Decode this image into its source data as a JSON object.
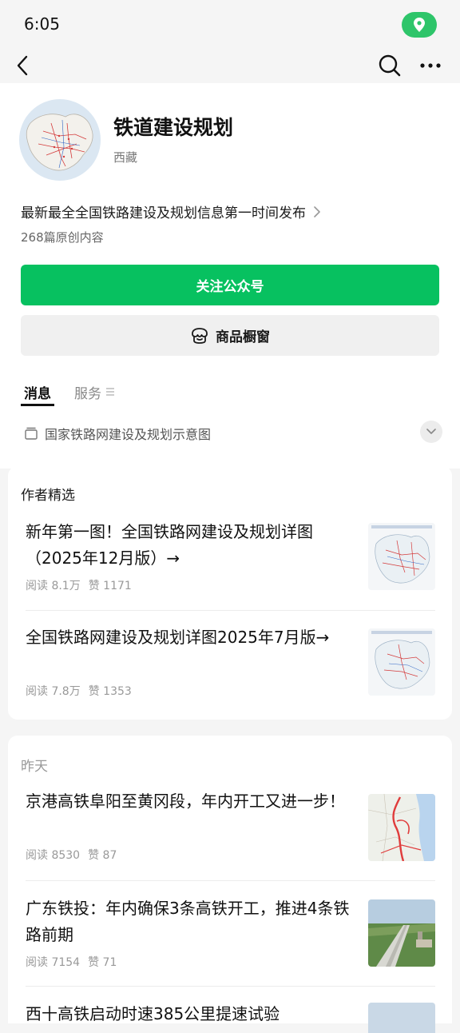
{
  "status_bar": {
    "time": "6:05"
  },
  "account": {
    "name": "铁道建设规划",
    "region": "西藏",
    "intro": "最新最全全国铁路建设及规划信息第一时间发布",
    "original_count": "268篇原创内容"
  },
  "actions": {
    "follow_label": "关注公众号",
    "shop_label": "商品橱窗"
  },
  "tabs": {
    "messages": "消息",
    "services": "服务"
  },
  "collection": {
    "label": "国家铁路网建设及规划示意图"
  },
  "featured": {
    "title": "作者精选",
    "articles": [
      {
        "title": "新年第一图！全国铁路网建设及规划详图（2025年12月版）→",
        "reads": "阅读 8.1万",
        "likes": "赞 1171"
      },
      {
        "title": "全国铁路网建设及规划详图2025年7月版→",
        "reads": "阅读 7.8万",
        "likes": "赞 1353"
      }
    ]
  },
  "yesterday": {
    "title": "昨天",
    "articles": [
      {
        "title": "京港高铁阜阳至黄冈段，年内开工又进一步！",
        "reads": "阅读 8530",
        "likes": "赞 87"
      },
      {
        "title": "广东铁投：年内确保3条高铁开工，推进4条铁路前期",
        "reads": "阅读 7154",
        "likes": "赞 71"
      },
      {
        "title": "西十高铁启动时速385公里提速试验"
      }
    ]
  },
  "colors": {
    "accent": "#07c160",
    "status_pill": "#2ec56a"
  }
}
